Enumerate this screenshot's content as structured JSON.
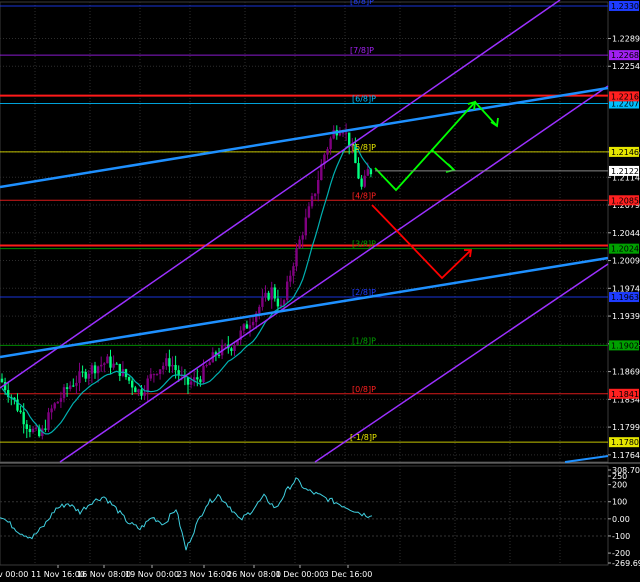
{
  "chart_data": [
    {
      "type": "candlestick",
      "symbol_pane": "price",
      "y_axis_ticks": [
        "1.2289",
        "1.2254",
        "1.2146",
        "1.2114",
        "1.2079",
        "1.2044",
        "1.2009",
        "1.1974",
        "1.1939",
        "1.1904",
        "1.1869",
        "1.1834",
        "1.1799",
        "1.1764"
      ],
      "ylim": [
        1.1755,
        1.2335
      ],
      "x_axis_ticks": [
        "11 Nov 16:00",
        "16 Nov 08:00",
        "19 Nov 00:00",
        "23 Nov 16:00",
        "26 Nov 08:00",
        "1 Dec 00:00",
        "3 Dec 16:00"
      ],
      "x_axis_partial_left": "v 00:00",
      "murrey_levels": [
        {
          "label": "[8/8]P",
          "value": 1.233,
          "color": "#1e3cff",
          "tag": "1.2330"
        },
        {
          "label": "[7/8]P",
          "value": 1.2268,
          "color": "#a020f0",
          "tag": "1.2268"
        },
        {
          "label": "[6/8]P",
          "value": 1.2207,
          "color": "#00bfff",
          "tag": "1.2207"
        },
        {
          "label": "[5/8]P",
          "value": 1.2146,
          "color": "#e6e600",
          "tag": "1.2146"
        },
        {
          "label": "[4/8]P",
          "value": 1.2085,
          "color": "#ff2020",
          "tag": "1.2085"
        },
        {
          "label": "[3/8]P",
          "value": 1.2024,
          "color": "#00a000",
          "tag": "1.2024"
        },
        {
          "label": "[2/8]P",
          "value": 1.1963,
          "color": "#1e3cff",
          "tag": "1.1963"
        },
        {
          "label": "[1/8]P",
          "value": 1.1902,
          "color": "#00a000",
          "tag": "1.1902"
        },
        {
          "label": "[0/8]P",
          "value": 1.1841,
          "color": "#ff2020",
          "tag": "1.1841"
        },
        {
          "label": "[-1/8]P",
          "value": 1.178,
          "color": "#e6e600",
          "tag": "1.1780"
        }
      ],
      "red_lines": [
        1.2217,
        1.2028
      ],
      "price_tags": [
        {
          "value": 1.2216,
          "text": "1.2216",
          "color": "#ff2020"
        },
        {
          "value": 1.2122,
          "text": "1.2122",
          "color": "#ffffff"
        }
      ],
      "current_price": 1.2122,
      "ma_color": "#00b0b0",
      "bull_color": "#800080",
      "bear_color": "#00ff7f",
      "channel_color": "#9b30ff",
      "trend_color": "#1e90ff",
      "forecast_up_color": "#00ff00",
      "forecast_down_color": "#ff0000"
    },
    {
      "type": "line",
      "symbol_pane": "oscillator",
      "y_axis_ticks": [
        "308.7018",
        "250",
        "200",
        "100",
        "0.00",
        "-100",
        "-200",
        "-269.695"
      ],
      "ylim": [
        -269.695,
        308.7018
      ],
      "color": "#40d0e0"
    }
  ]
}
